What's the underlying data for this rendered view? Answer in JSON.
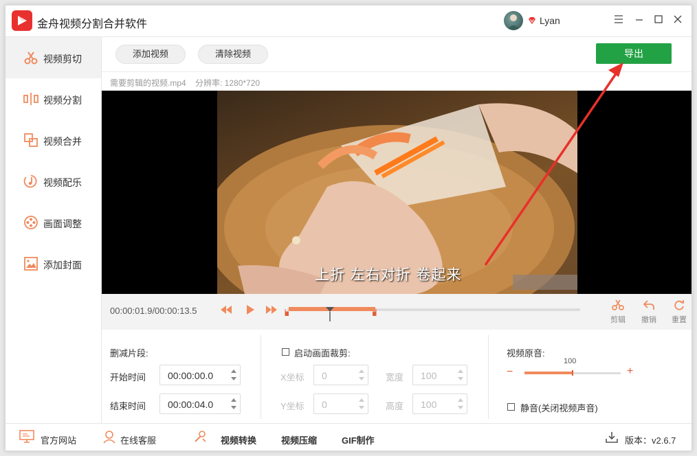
{
  "app": {
    "title": "金舟视频分割合并软件",
    "user_name": "Lyan"
  },
  "sidebar": {
    "items": [
      {
        "label": "视频剪切",
        "icon": "scissors-icon"
      },
      {
        "label": "视频分割",
        "icon": "split-icon"
      },
      {
        "label": "视频合并",
        "icon": "merge-icon"
      },
      {
        "label": "视频配乐",
        "icon": "music-icon"
      },
      {
        "label": "画面调整",
        "icon": "film-reel-icon"
      },
      {
        "label": "添加封面",
        "icon": "image-icon"
      }
    ]
  },
  "toolbar": {
    "add_video": "添加视频",
    "clear_video": "清除视频",
    "export": "导出"
  },
  "file_info": {
    "name": "需要剪辑的视频.mp4",
    "resolution": "分辨率: 1280*720"
  },
  "video": {
    "subtitle": "上折 左右对折  卷起来"
  },
  "timeline": {
    "time_display": "00:00:01.9/00:00:13.5",
    "tools": {
      "cut": "剪辑",
      "undo": "撤销",
      "reset": "重置"
    },
    "playhead_fraction": 0.14,
    "selection_start_fraction": 0.0,
    "selection_end_fraction": 0.296
  },
  "delete_segment": {
    "title": "删减片段:",
    "start_label": "开始时间",
    "start_value": "00:00:00.0",
    "end_label": "结束时间",
    "end_value": "00:00:04.0"
  },
  "crop": {
    "checkbox_label": "启动画面裁剪:",
    "x_label": "X坐标",
    "x_value": "0",
    "y_label": "Y坐标",
    "y_value": "0",
    "width_label": "宽度",
    "width_value": "100",
    "height_label": "高度",
    "height_value": "100"
  },
  "audio": {
    "title": "视频原音:",
    "volume_value": "100",
    "volume_fraction": 0.5,
    "mute_label": "静音(关闭视频声音)",
    "minus": "−",
    "plus": "+"
  },
  "footer": {
    "website": "官方网站",
    "support": "在线客服",
    "convert": "视频转换",
    "compress": "视频压缩",
    "gif": "GIF制作",
    "version": "版本：v2.6.7"
  },
  "colors": {
    "accent": "#f08a5d",
    "export_green": "#22a245",
    "brand_red": "#e8312f",
    "arrow_red": "#e8302a"
  }
}
